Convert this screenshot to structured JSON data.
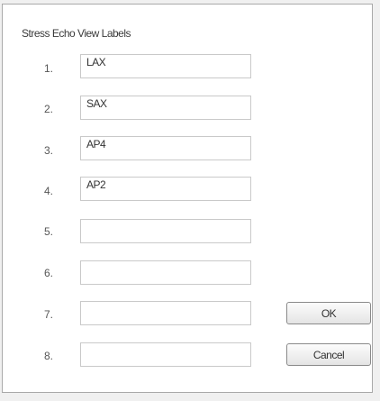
{
  "dialog": {
    "title": "Stress Echo View Labels"
  },
  "rows": [
    {
      "number": "1.",
      "value": "LAX"
    },
    {
      "number": "2.",
      "value": "SAX"
    },
    {
      "number": "3.",
      "value": "AP4"
    },
    {
      "number": "4.",
      "value": "AP2"
    },
    {
      "number": "5.",
      "value": ""
    },
    {
      "number": "6.",
      "value": ""
    },
    {
      "number": "7.",
      "value": ""
    },
    {
      "number": "8.",
      "value": ""
    }
  ],
  "buttons": {
    "ok_label": "OK",
    "cancel_label": "Cancel"
  }
}
